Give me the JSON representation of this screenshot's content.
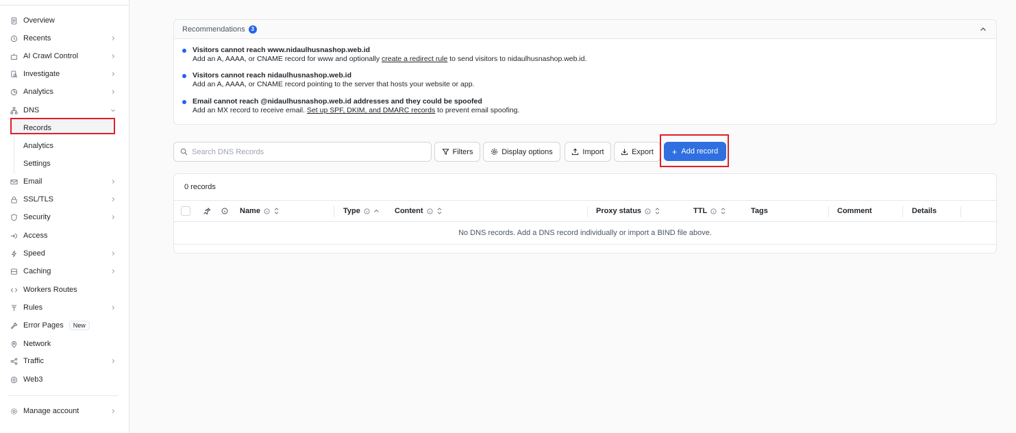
{
  "sidebar": {
    "items": [
      {
        "label": "Overview",
        "icon": "document-icon"
      },
      {
        "label": "Recents",
        "icon": "clock-icon"
      },
      {
        "label": "AI Crawl Control",
        "icon": "robot-icon"
      },
      {
        "label": "Investigate",
        "icon": "search-doc-icon"
      },
      {
        "label": "Analytics",
        "icon": "chart-icon"
      },
      {
        "label": "DNS",
        "icon": "sitemap-icon"
      },
      {
        "label": "Email",
        "icon": "envelope-icon"
      },
      {
        "label": "SSL/TLS",
        "icon": "lock-icon"
      },
      {
        "label": "Security",
        "icon": "shield-icon"
      },
      {
        "label": "Access",
        "icon": "enter-icon"
      },
      {
        "label": "Speed",
        "icon": "lightning-icon"
      },
      {
        "label": "Caching",
        "icon": "database-icon"
      },
      {
        "label": "Workers Routes",
        "icon": "code-icon"
      },
      {
        "label": "Rules",
        "icon": "filter-icon"
      },
      {
        "label": "Error Pages",
        "icon": "wrench-icon",
        "badge": "New"
      },
      {
        "label": "Network",
        "icon": "pin-icon"
      },
      {
        "label": "Traffic",
        "icon": "share-icon"
      },
      {
        "label": "Web3",
        "icon": "globe-icon"
      }
    ],
    "dns_sub": [
      "Records",
      "Analytics",
      "Settings"
    ],
    "manage_account": "Manage account"
  },
  "recommendations": {
    "title": "Recommendations",
    "count": "3",
    "items": [
      {
        "title": "Visitors cannot reach www.nidaulhusnashop.web.id",
        "desc_before": "Add an A, AAAA, or CNAME record for www and optionally ",
        "link": "create a redirect rule",
        "desc_after": " to send visitors to nidaulhusnashop.web.id."
      },
      {
        "title": "Visitors cannot reach nidaulhusnashop.web.id",
        "desc_before": "Add an A, AAAA, or CNAME record pointing to the server that hosts your website or app.",
        "link": "",
        "desc_after": ""
      },
      {
        "title": "Email cannot reach @nidaulhusnashop.web.id addresses and they could be spoofed",
        "desc_before": "Add an MX record to receive email. ",
        "link": "Set up SPF, DKIM, and DMARC records",
        "desc_after": " to prevent email spoofing."
      }
    ]
  },
  "toolbar": {
    "search_placeholder": "Search DNS Records",
    "filters": "Filters",
    "display_options": "Display options",
    "import": "Import",
    "export": "Export",
    "add_record": "Add record"
  },
  "table": {
    "count_label": "0 records",
    "columns": {
      "name": "Name",
      "type": "Type",
      "content": "Content",
      "proxy_status": "Proxy status",
      "ttl": "TTL",
      "tags": "Tags",
      "comment": "Comment",
      "details": "Details"
    },
    "empty_message": "No DNS records. Add a DNS record individually or import a BIND file above."
  },
  "colors": {
    "accent": "#2f6fe0",
    "highlight": "#e01e26"
  }
}
